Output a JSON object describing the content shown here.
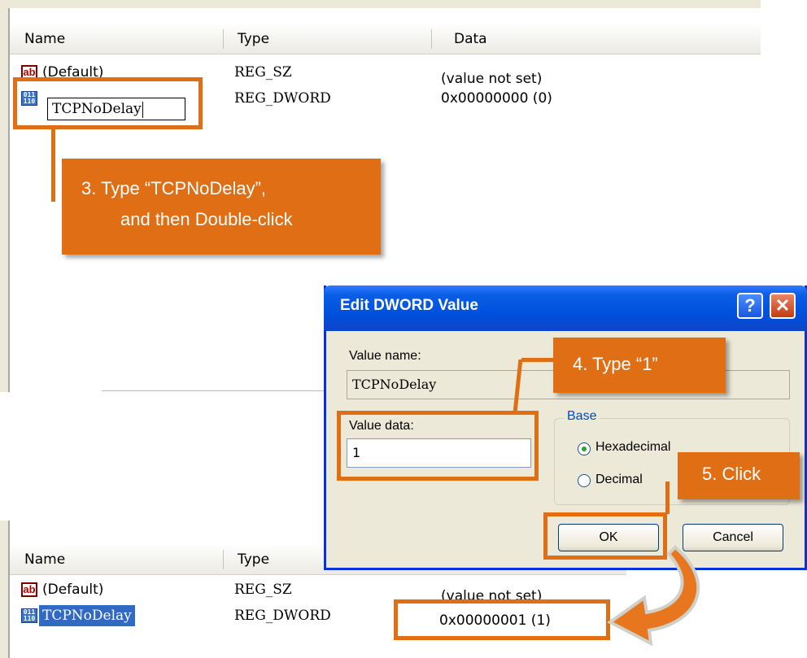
{
  "columns": {
    "name": "Name",
    "type": "Type",
    "data": "Data"
  },
  "top_rows": [
    {
      "name": "(Default)",
      "type": "REG_SZ",
      "data": "(value not set)",
      "icon": "ab-icon"
    },
    {
      "name": "TCPNoDelay",
      "type": "REG_DWORD",
      "data": "0x00000000 (0)",
      "icon": "binary-icon"
    }
  ],
  "callout3": {
    "line1": "3.  Type “TCPNoDelay”,",
    "line2": "and then Double-click"
  },
  "dialog": {
    "title": "Edit DWORD Value",
    "help_glyph": "?",
    "close_glyph": "✕",
    "value_name_label": "Value name:",
    "value_name": "TCPNoDelay",
    "value_data_label": "Value data:",
    "value_data": "1",
    "base_label": "Base",
    "hex_label": "Hexadecimal",
    "dec_label": "Decimal",
    "ok_label": "OK",
    "cancel_label": "Cancel",
    "base_selected": "Hexadecimal"
  },
  "callout4": "4.  Type “1”",
  "callout5": "5.  Click",
  "bottom_rows": [
    {
      "name": "(Default)",
      "type": "REG_SZ",
      "data": "(value not set)"
    },
    {
      "name": "TCPNoDelay",
      "type": "REG_DWORD",
      "data": "0x00000001 (1)"
    }
  ],
  "colors": {
    "accent": "#df6e14",
    "titlebar": "#0050dd",
    "selection": "#316ac5"
  }
}
